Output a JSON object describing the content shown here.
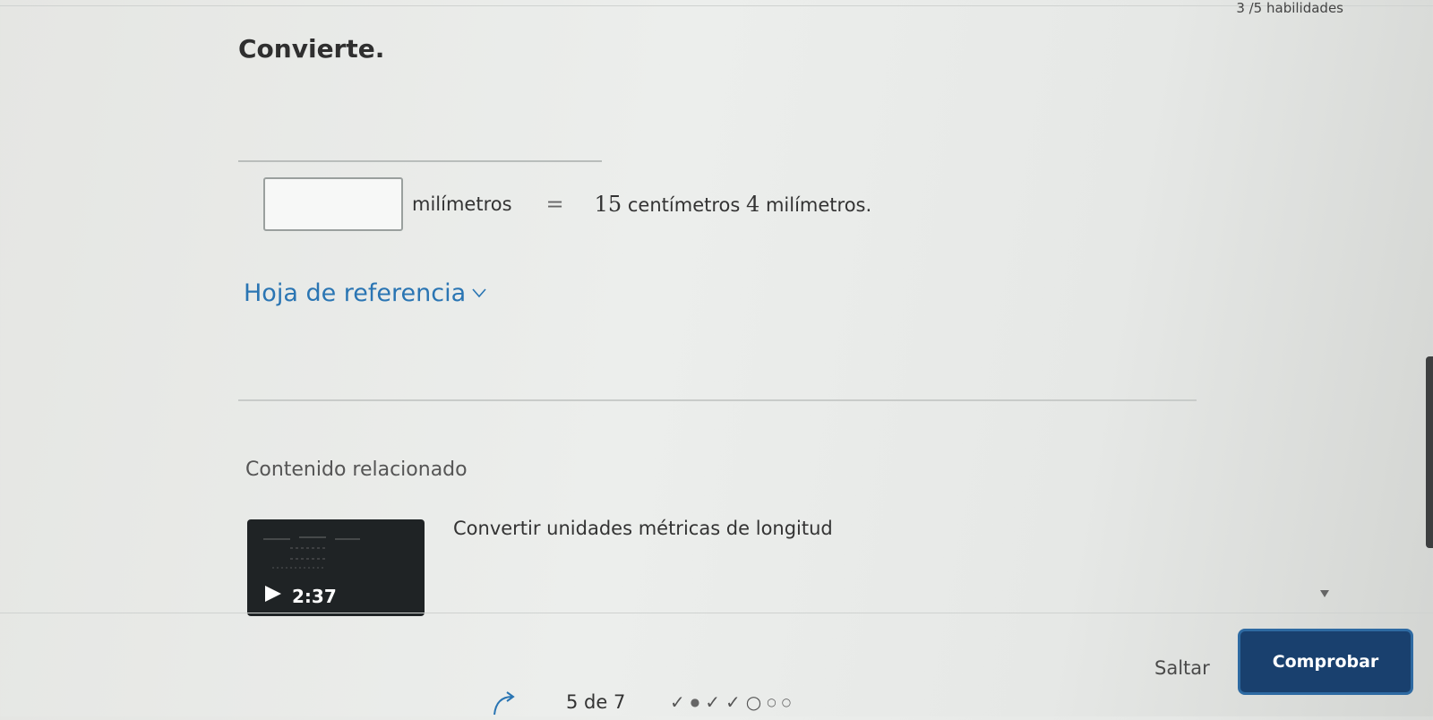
{
  "header": {
    "skills_progress": "3 /5 habilidades"
  },
  "question": {
    "title": "Convierte.",
    "input_value": "",
    "input_unit": "milímetros",
    "equals": "=",
    "rhs_num1": "15",
    "rhs_unit1": "centímetros",
    "rhs_num2": "4",
    "rhs_unit2": "milímetros."
  },
  "reference": {
    "label": "Hoja de referencia",
    "icon": "chevron-down-icon"
  },
  "related": {
    "heading": "Contenido relacionado",
    "video": {
      "title": "Convertir unidades métricas de longitud",
      "duration": "2:37"
    }
  },
  "footer": {
    "skip_label": "Saltar",
    "check_label": "Comprobar",
    "progress_text": "5 de 7",
    "progress_marks": [
      "check",
      "current",
      "check",
      "check",
      "empty-large",
      "empty-small",
      "empty-small"
    ]
  },
  "colors": {
    "link": "#2a75b3",
    "primary_button": "#19406e",
    "primary_button_border": "#2e6aa2"
  }
}
